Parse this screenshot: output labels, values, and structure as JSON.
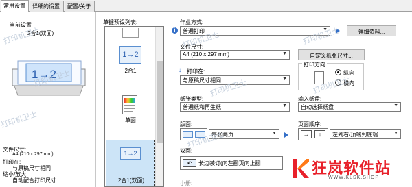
{
  "tabs": [
    "常用设置",
    "详细的设置",
    "配置/关于"
  ],
  "left": {
    "current_settings_label": "当前设置",
    "preset_name": "2合1(双面)",
    "preview_text": "1→2",
    "summary": {
      "paper_size_label": "文件尺寸:",
      "paper_size_value": "A4 (210 x 297 mm)",
      "print_on_label": "打印在:",
      "print_on_value": "与原稿尺寸相同",
      "scale_label": "缩小/放大:",
      "scale_value": "自动配合打印尺寸"
    }
  },
  "presets": {
    "title": "单键预设列表:",
    "items": [
      {
        "label": "",
        "icon": "blank-page-icon"
      },
      {
        "label": "2合1",
        "icon": "two-in-one-icon",
        "icon_text": "1→2"
      },
      {
        "label": "单面",
        "icon": "single-sided-icon"
      },
      {
        "label": "2合1(双面)",
        "icon": "two-in-one-duplex-icon",
        "icon_text": "1→2"
      }
    ]
  },
  "job": {
    "label": "作业方式:",
    "value": "普通打印",
    "details_button": "详细资料..."
  },
  "paper_size": {
    "label": "文件尺寸:",
    "value": "A4 (210 x 297 mm)",
    "custom_button": "自定义纸张尺寸..."
  },
  "print_on": {
    "label": "打印在:",
    "value": "与原稿尺寸相同"
  },
  "orientation": {
    "label": "打印方向",
    "portrait": "纵向",
    "landscape": "横向",
    "selected": "portrait"
  },
  "paper_type": {
    "label": "纸张类型:",
    "value": "普通纸和再生纸"
  },
  "paper_source": {
    "label": "输入纸盘:",
    "value": "自动选择纸盘"
  },
  "layout": {
    "label": "版面:",
    "value": "每张两页"
  },
  "page_order": {
    "label": "页面顺序:",
    "value": "左到右/顶端到底端"
  },
  "duplex": {
    "label": "双面:",
    "value": "长边装订(向左翻页向上翻"
  },
  "booklet": {
    "label": "小册:"
  },
  "watermarks": [
    "打印机卫士",
    "打印机卫士",
    "打印机卫士",
    "打印机卫士",
    "打印机卫士",
    "打印机卫士",
    "打印机卫士",
    "打印机卫士"
  ],
  "brand": {
    "name": "狂岚软件站",
    "url": "WWW.KLSK.SHOP",
    "color": "#e8202a"
  }
}
